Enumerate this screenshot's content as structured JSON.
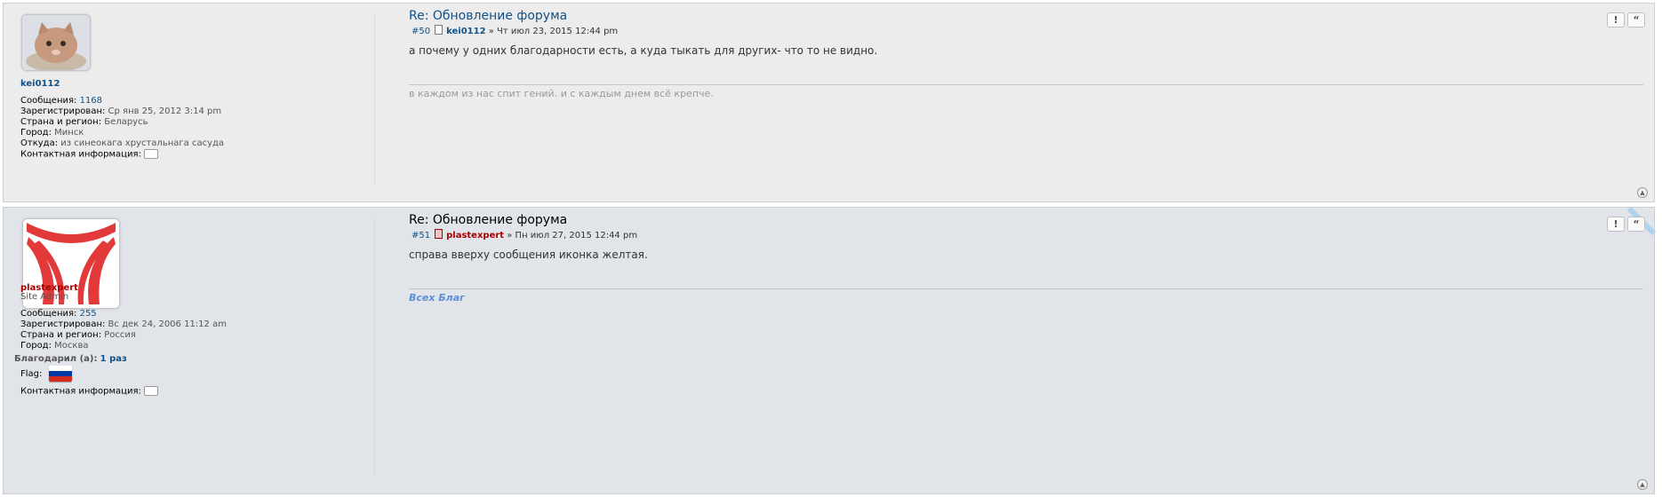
{
  "posts": [
    {
      "username": "kei0112",
      "fields": [
        {
          "label": "Сообщения:",
          "value": "1168"
        },
        {
          "label": "Зарегистрирован:",
          "value": "Ср янв 25, 2012 3:14 pm"
        },
        {
          "label": "Страна и регион:",
          "value": "Беларусь"
        },
        {
          "label": "Город:",
          "value": "Минск"
        },
        {
          "label": "Откуда:",
          "value": "из синеокага хрустальнага сасуда"
        },
        {
          "label": "Контактная информация:",
          "value": ""
        }
      ],
      "title": "Re: Обновление форума",
      "number": "#50",
      "author": "kei0112",
      "date": "» Чт июл 23, 2015 12:44 pm",
      "content": "а почему у одних благодарности есть, а куда тыкать для других- что то не видно.",
      "signature": "в каждом из нас спит гений. и с каждым днем всё крепче.",
      "report_label": "!",
      "quote_label": "“",
      "top_label": "▲"
    },
    {
      "username": "plastexpert",
      "rank": "Site Admin",
      "fields": [
        {
          "label": "Сообщения:",
          "value": "255"
        },
        {
          "label": "Зарегистрирован:",
          "value": "Вс дек 24, 2006 11:12 am"
        },
        {
          "label": "Страна и регион:",
          "value": "Россия"
        },
        {
          "label": "Город:",
          "value": "Москва"
        }
      ],
      "thanks_label": "Благодарил (а):",
      "thanks_value": "1 раз",
      "flag_label": "Flag:",
      "contact_label": "Контактная информация:",
      "title": "Re: Обновление форума",
      "number": "#51",
      "author": "plastexpert",
      "date": "» Пн июл 27, 2015 12:44 pm",
      "content": "справа вверху сообщения иконка желтая.",
      "signature": "Всех Благ",
      "report_label": "!",
      "quote_label": "“",
      "top_label": "▲"
    }
  ],
  "colors": {
    "link": "#105289",
    "admin": "#aa0000",
    "flag": [
      "#ffffff",
      "#0039a6",
      "#d52b1e"
    ]
  }
}
